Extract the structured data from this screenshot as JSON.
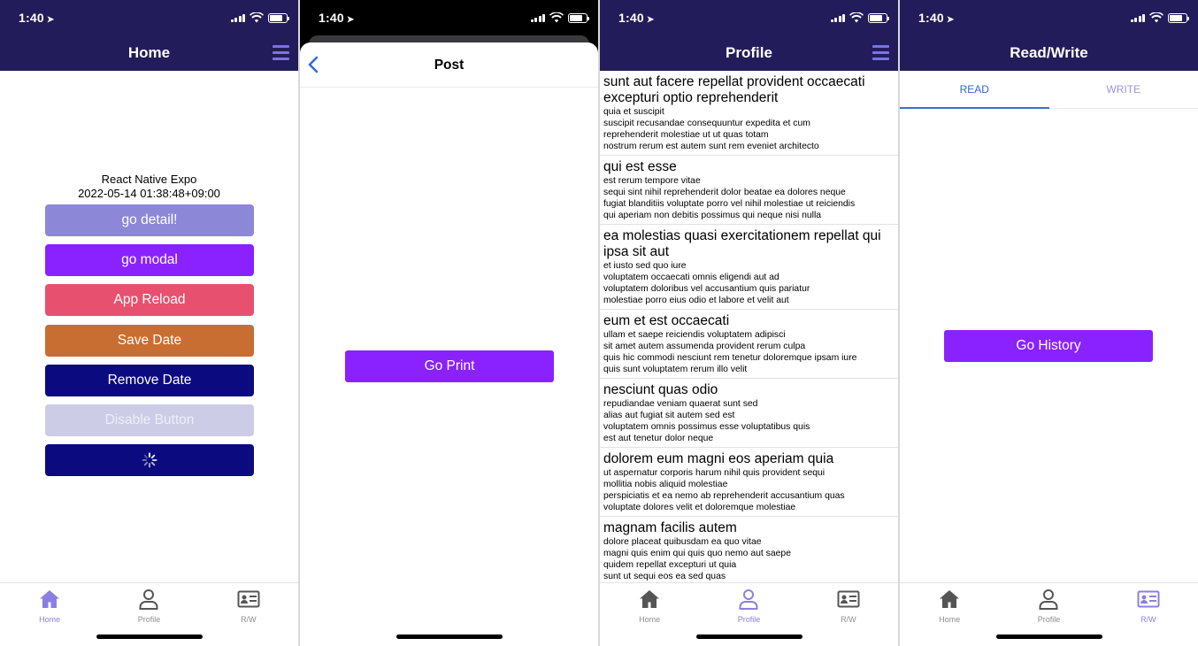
{
  "status": {
    "time": "1:40"
  },
  "colors": {
    "header_bg": "#231c5a",
    "accent": "#8a80e0",
    "go_detail": "#8c87d6",
    "go_modal": "#8a22ff",
    "app_reload": "#e8506f",
    "save_date": "#c96e32",
    "remove_date": "#0b0a7e",
    "disable_button": "#cccce6",
    "loading_button": "#0b0a7e"
  },
  "home": {
    "title": "Home",
    "app_name": "React Native Expo",
    "date": "2022-05-14 01:38:48+09:00",
    "buttons": {
      "go_detail": "go detail!",
      "go_modal": "go modal",
      "app_reload": "App Reload",
      "save_date": "Save Date",
      "remove_date": "Remove Date",
      "disable_button": "Disable Button"
    }
  },
  "modal": {
    "title": "Post",
    "go_print": "Go Print"
  },
  "profile": {
    "title": "Profile",
    "posts": [
      {
        "title": "sunt aut facere repellat provident occaecati excepturi optio reprehenderit",
        "body": "quia et suscipit\nsuscipit recusandae consequuntur expedita et cum\nreprehenderit molestiae ut ut quas totam\nnostrum rerum est autem sunt rem eveniet architecto"
      },
      {
        "title": "qui est esse",
        "body": "est rerum tempore vitae\nsequi sint nihil reprehenderit dolor beatae ea dolores neque\nfugiat blanditiis voluptate porro vel nihil molestiae ut reiciendis\nqui aperiam non debitis possimus qui neque nisi nulla"
      },
      {
        "title": "ea molestias quasi exercitationem repellat qui ipsa sit aut",
        "body": "et iusto sed quo iure\nvoluptatem occaecati omnis eligendi aut ad\nvoluptatem doloribus vel accusantium quis pariatur\nmolestiae porro eius odio et labore et velit aut"
      },
      {
        "title": "eum et est occaecati",
        "body": "ullam et saepe reiciendis voluptatem adipisci\nsit amet autem assumenda provident rerum culpa\nquis hic commodi nesciunt rem tenetur doloremque ipsam iure\nquis sunt voluptatem rerum illo velit"
      },
      {
        "title": "nesciunt quas odio",
        "body": "repudiandae veniam quaerat sunt sed\nalias aut fugiat sit autem sed est\nvoluptatem omnis possimus esse voluptatibus quis\nest aut tenetur dolor neque"
      },
      {
        "title": "dolorem eum magni eos aperiam quia",
        "body": "ut aspernatur corporis harum nihil quis provident sequi\nmollitia nobis aliquid molestiae\nperspiciatis et ea nemo ab reprehenderit accusantium quas\nvoluptate dolores velit et doloremque molestiae"
      },
      {
        "title": "magnam facilis autem",
        "body": "dolore placeat quibusdam ea quo vitae\nmagni quis enim qui quis quo nemo aut saepe\nquidem repellat excepturi ut quia\nsunt ut sequi eos ea sed quas"
      }
    ]
  },
  "readwrite": {
    "title": "Read/Write",
    "tabs": [
      "READ",
      "WRITE"
    ],
    "go_history": "Go History"
  },
  "tabbar": {
    "home": "Home",
    "profile": "Profile",
    "rw": "R/W"
  }
}
